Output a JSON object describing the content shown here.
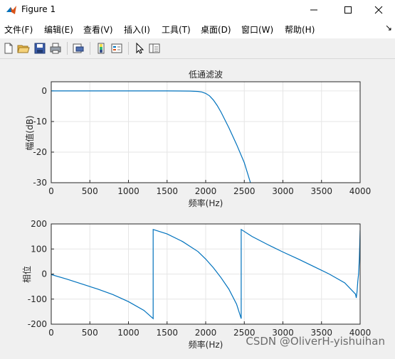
{
  "window": {
    "title": "Figure 1",
    "minimize_icon": "minimize-icon",
    "maximize_icon": "maximize-icon",
    "close_icon": "close-icon"
  },
  "menu": [
    {
      "label": "文件(F)"
    },
    {
      "label": "编辑(E)"
    },
    {
      "label": "查看(V)"
    },
    {
      "label": "插入(I)"
    },
    {
      "label": "工具(T)"
    },
    {
      "label": "桌面(D)"
    },
    {
      "label": "窗口(W)"
    },
    {
      "label": "帮助(H)"
    }
  ],
  "menu_overflow": "↘",
  "toolbar": [
    "new-figure-icon",
    "open-file-icon",
    "save-icon",
    "print-icon",
    "print-preview-icon",
    "colorbar-icon",
    "legend-icon",
    "pointer-icon",
    "property-editor-icon"
  ],
  "watermark": "CSDN @OliverH-yishuihan",
  "chart_data": [
    {
      "type": "line",
      "title": "低通滤波",
      "xlabel": "频率(Hz)",
      "ylabel": "幅值(dB)",
      "xlim": [
        0,
        4000
      ],
      "ylim": [
        -30,
        3
      ],
      "xticks": [
        0,
        500,
        1000,
        1500,
        2000,
        2500,
        3000,
        3500,
        4000
      ],
      "yticks": [
        0,
        -10,
        -20,
        -30
      ],
      "grid": true,
      "color": "#0072bd",
      "series": [
        {
          "x": [
            0,
            500,
            1000,
            1500,
            1800,
            1900,
            1950,
            2000,
            2050,
            2100,
            2150,
            2200,
            2300,
            2400,
            2500,
            2580
          ],
          "y": [
            0,
            0,
            0,
            0,
            -0.05,
            -0.15,
            -0.35,
            -0.8,
            -1.6,
            -3.0,
            -4.8,
            -7.0,
            -12.0,
            -17.5,
            -23.5,
            -30
          ]
        }
      ]
    },
    {
      "type": "line",
      "title": "",
      "xlabel": "频率(Hz)",
      "ylabel": "相位",
      "xlim": [
        0,
        4000
      ],
      "ylim": [
        -200,
        200
      ],
      "xticks": [
        0,
        500,
        1000,
        1500,
        2000,
        2500,
        3000,
        3500,
        4000
      ],
      "yticks": [
        200,
        100,
        0,
        -100,
        -200
      ],
      "grid": true,
      "color": "#0072bd",
      "series": [
        {
          "x": [
            0,
            200,
            400,
            600,
            800,
            1000,
            1200,
            1320,
            1320,
            1500,
            1700,
            1900,
            2000,
            2100,
            2200,
            2300,
            2400,
            2460,
            2460,
            2600,
            2800,
            3000,
            3200,
            3400,
            3600,
            3800,
            3940,
            3950,
            3960,
            3970,
            3980,
            3990,
            4000
          ],
          "y": [
            -2,
            -20,
            -40,
            -60,
            -82,
            -110,
            -145,
            -178,
            178,
            160,
            130,
            90,
            60,
            25,
            -15,
            -60,
            -120,
            -178,
            178,
            150,
            118,
            88,
            60,
            30,
            0,
            -35,
            -80,
            -95,
            -70,
            -30,
            0,
            60,
            175
          ]
        }
      ]
    }
  ]
}
